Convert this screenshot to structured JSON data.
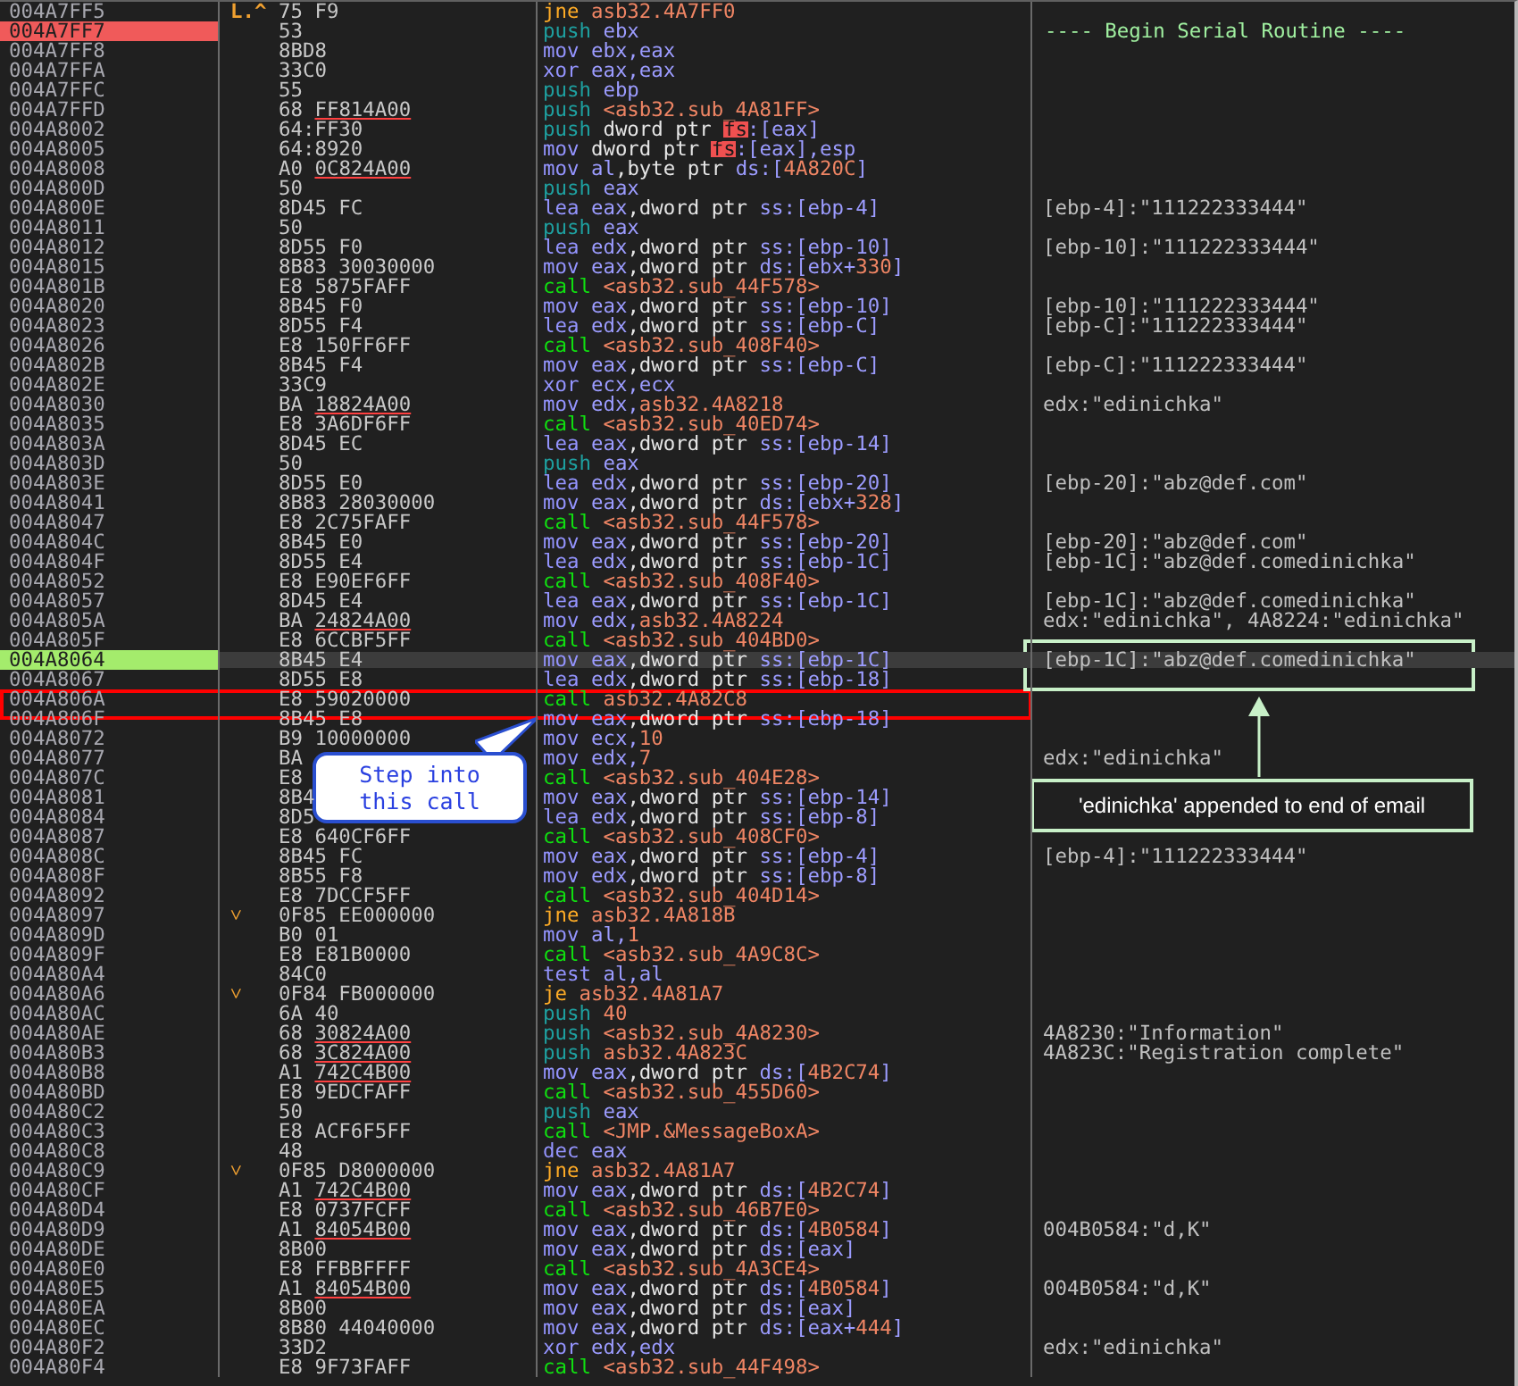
{
  "rows": [
    {
      "address": "004A7FF5",
      "branch_mark": "L.^",
      "bytes": "75 F9",
      "tokens": [
        {
          "text": "jne",
          "kind": "jump"
        },
        {
          "text": "asb32.4A7FF0",
          "kind": "address"
        }
      ],
      "breakpoint": false,
      "current": false
    },
    {
      "address": "004A7FF7",
      "bytes": "53",
      "tokens": [
        {
          "text": "push",
          "kind": "stack"
        },
        {
          "text": "ebx",
          "kind": "register"
        }
      ],
      "comment": {
        "text": "---- Begin Serial Routine ----",
        "kind": "label"
      },
      "breakpoint": true,
      "current": false
    },
    {
      "address": "004A7FF8",
      "bytes": "8BD8",
      "tokens": [
        {
          "text": "mov",
          "kind": "data"
        },
        {
          "text": "ebx,eax",
          "kind": "register"
        }
      ],
      "breakpoint": false,
      "current": false
    },
    {
      "address": "004A7FFA",
      "bytes": "33C0",
      "tokens": [
        {
          "text": "xor",
          "kind": "data"
        },
        {
          "text": "eax,eax",
          "kind": "register"
        }
      ],
      "breakpoint": false,
      "current": false
    },
    {
      "address": "004A7FFC",
      "bytes": "55",
      "tokens": [
        {
          "text": "push",
          "kind": "stack"
        },
        {
          "text": "ebp",
          "kind": "register"
        }
      ],
      "breakpoint": false,
      "current": false
    },
    {
      "address": "004A7FFD",
      "bytes": "68 ",
      "reloc": "FF814A00",
      "tokens": [
        {
          "text": "push",
          "kind": "stack"
        },
        {
          "text": "<asb32.sub_4A81FF>",
          "kind": "address"
        }
      ],
      "breakpoint": false,
      "current": false
    },
    {
      "address": "004A8002",
      "bytes": "64:FF30",
      "tokens": [
        {
          "text": "push",
          "kind": "stack"
        },
        {
          "text": "dword ptr ",
          "kind": "plain"
        },
        {
          "text": "fs",
          "kind": "segment"
        },
        {
          "text": ":[eax]",
          "kind": "register"
        }
      ],
      "breakpoint": false,
      "current": false
    },
    {
      "address": "004A8005",
      "bytes": "64:8920",
      "tokens": [
        {
          "text": "mov",
          "kind": "data"
        },
        {
          "text": "dword ptr ",
          "kind": "plain"
        },
        {
          "text": "fs",
          "kind": "segment"
        },
        {
          "text": ":[eax],esp",
          "kind": "register"
        }
      ],
      "breakpoint": false,
      "current": false
    },
    {
      "address": "004A8008",
      "bytes": "A0 ",
      "reloc": "0C824A00",
      "tokens": [
        {
          "text": "mov",
          "kind": "data"
        },
        {
          "text": "al",
          "kind": "register"
        },
        {
          "text": ",byte ptr ",
          "kind": "plain"
        },
        {
          "text": "ds:[",
          "kind": "register"
        },
        {
          "text": "4A820C",
          "kind": "address"
        },
        {
          "text": "]",
          "kind": "register"
        }
      ],
      "breakpoint": false,
      "current": false
    },
    {
      "address": "004A800D",
      "bytes": "50",
      "tokens": [
        {
          "text": "push",
          "kind": "stack"
        },
        {
          "text": "eax",
          "kind": "register"
        }
      ],
      "breakpoint": false,
      "current": false
    },
    {
      "address": "004A800E",
      "bytes": "8D45 FC",
      "tokens": [
        {
          "text": "lea",
          "kind": "data"
        },
        {
          "text": "eax",
          "kind": "register"
        },
        {
          "text": ",dword ptr ",
          "kind": "plain"
        },
        {
          "text": "ss:[ebp-4]",
          "kind": "register"
        }
      ],
      "comment": {
        "text": "[ebp-4]:\"111222333444\"",
        "kind": "auto"
      },
      "breakpoint": false,
      "current": false
    },
    {
      "address": "004A8011",
      "bytes": "50",
      "tokens": [
        {
          "text": "push",
          "kind": "stack"
        },
        {
          "text": "eax",
          "kind": "register"
        }
      ],
      "breakpoint": false,
      "current": false
    },
    {
      "address": "004A8012",
      "bytes": "8D55 F0",
      "tokens": [
        {
          "text": "lea",
          "kind": "data"
        },
        {
          "text": "edx",
          "kind": "register"
        },
        {
          "text": ",dword ptr ",
          "kind": "plain"
        },
        {
          "text": "ss:[ebp-10]",
          "kind": "register"
        }
      ],
      "comment": {
        "text": "[ebp-10]:\"111222333444\"",
        "kind": "auto"
      },
      "breakpoint": false,
      "current": false
    },
    {
      "address": "004A8015",
      "bytes": "8B83 30030000",
      "tokens": [
        {
          "text": "mov",
          "kind": "data"
        },
        {
          "text": "eax",
          "kind": "register"
        },
        {
          "text": ",dword ptr ",
          "kind": "plain"
        },
        {
          "text": "ds:[ebx+",
          "kind": "register"
        },
        {
          "text": "330",
          "kind": "address"
        },
        {
          "text": "]",
          "kind": "register"
        }
      ],
      "breakpoint": false,
      "current": false
    },
    {
      "address": "004A801B",
      "bytes": "E8 5875FAFF",
      "tokens": [
        {
          "text": "call",
          "kind": "call"
        },
        {
          "text": "<asb32.sub_44F578>",
          "kind": "address"
        }
      ],
      "breakpoint": false,
      "current": false
    },
    {
      "address": "004A8020",
      "bytes": "8B45 F0",
      "tokens": [
        {
          "text": "mov",
          "kind": "data"
        },
        {
          "text": "eax",
          "kind": "register"
        },
        {
          "text": ",dword ptr ",
          "kind": "plain"
        },
        {
          "text": "ss:[ebp-10]",
          "kind": "register"
        }
      ],
      "comment": {
        "text": "[ebp-10]:\"111222333444\"",
        "kind": "auto"
      },
      "breakpoint": false,
      "current": false
    },
    {
      "address": "004A8023",
      "bytes": "8D55 F4",
      "tokens": [
        {
          "text": "lea",
          "kind": "data"
        },
        {
          "text": "edx",
          "kind": "register"
        },
        {
          "text": ",dword ptr ",
          "kind": "plain"
        },
        {
          "text": "ss:[ebp-C]",
          "kind": "register"
        }
      ],
      "comment": {
        "text": "[ebp-C]:\"111222333444\"",
        "kind": "auto"
      },
      "breakpoint": false,
      "current": false
    },
    {
      "address": "004A8026",
      "bytes": "E8 150FF6FF",
      "tokens": [
        {
          "text": "call",
          "kind": "call"
        },
        {
          "text": "<asb32.sub_408F40>",
          "kind": "address"
        }
      ],
      "breakpoint": false,
      "current": false
    },
    {
      "address": "004A802B",
      "bytes": "8B45 F4",
      "tokens": [
        {
          "text": "mov",
          "kind": "data"
        },
        {
          "text": "eax",
          "kind": "register"
        },
        {
          "text": ",dword ptr ",
          "kind": "plain"
        },
        {
          "text": "ss:[ebp-C]",
          "kind": "register"
        }
      ],
      "comment": {
        "text": "[ebp-C]:\"111222333444\"",
        "kind": "auto"
      },
      "breakpoint": false,
      "current": false
    },
    {
      "address": "004A802E",
      "bytes": "33C9",
      "tokens": [
        {
          "text": "xor",
          "kind": "data"
        },
        {
          "text": "ecx,ecx",
          "kind": "register"
        }
      ],
      "breakpoint": false,
      "current": false
    },
    {
      "address": "004A8030",
      "bytes": "BA ",
      "reloc": "18824A00",
      "tokens": [
        {
          "text": "mov",
          "kind": "data"
        },
        {
          "text": "edx,",
          "kind": "register"
        },
        {
          "text": "asb32.4A8218",
          "kind": "address"
        }
      ],
      "comment": {
        "text": "edx:\"edinichka\"",
        "kind": "auto"
      },
      "breakpoint": false,
      "current": false
    },
    {
      "address": "004A8035",
      "bytes": "E8 3A6DF6FF",
      "tokens": [
        {
          "text": "call",
          "kind": "call"
        },
        {
          "text": "<asb32.sub_40ED74>",
          "kind": "address"
        }
      ],
      "breakpoint": false,
      "current": false
    },
    {
      "address": "004A803A",
      "bytes": "8D45 EC",
      "tokens": [
        {
          "text": "lea",
          "kind": "data"
        },
        {
          "text": "eax",
          "kind": "register"
        },
        {
          "text": ",dword ptr ",
          "kind": "plain"
        },
        {
          "text": "ss:[ebp-14]",
          "kind": "register"
        }
      ],
      "breakpoint": false,
      "current": false
    },
    {
      "address": "004A803D",
      "bytes": "50",
      "tokens": [
        {
          "text": "push",
          "kind": "stack"
        },
        {
          "text": "eax",
          "kind": "register"
        }
      ],
      "breakpoint": false,
      "current": false
    },
    {
      "address": "004A803E",
      "bytes": "8D55 E0",
      "tokens": [
        {
          "text": "lea",
          "kind": "data"
        },
        {
          "text": "edx",
          "kind": "register"
        },
        {
          "text": ",dword ptr ",
          "kind": "plain"
        },
        {
          "text": "ss:[ebp-20]",
          "kind": "register"
        }
      ],
      "comment": {
        "text": "[ebp-20]:\"abz@def.com\"",
        "kind": "auto"
      },
      "breakpoint": false,
      "current": false
    },
    {
      "address": "004A8041",
      "bytes": "8B83 28030000",
      "tokens": [
        {
          "text": "mov",
          "kind": "data"
        },
        {
          "text": "eax",
          "kind": "register"
        },
        {
          "text": ",dword ptr ",
          "kind": "plain"
        },
        {
          "text": "ds:[ebx+",
          "kind": "register"
        },
        {
          "text": "328",
          "kind": "address"
        },
        {
          "text": "]",
          "kind": "register"
        }
      ],
      "breakpoint": false,
      "current": false
    },
    {
      "address": "004A8047",
      "bytes": "E8 2C75FAFF",
      "tokens": [
        {
          "text": "call",
          "kind": "call"
        },
        {
          "text": "<asb32.sub_44F578>",
          "kind": "address"
        }
      ],
      "breakpoint": false,
      "current": false
    },
    {
      "address": "004A804C",
      "bytes": "8B45 E0",
      "tokens": [
        {
          "text": "mov",
          "kind": "data"
        },
        {
          "text": "eax",
          "kind": "register"
        },
        {
          "text": ",dword ptr ",
          "kind": "plain"
        },
        {
          "text": "ss:[ebp-20]",
          "kind": "register"
        }
      ],
      "comment": {
        "text": "[ebp-20]:\"abz@def.com\"",
        "kind": "auto"
      },
      "breakpoint": false,
      "current": false
    },
    {
      "address": "004A804F",
      "bytes": "8D55 E4",
      "tokens": [
        {
          "text": "lea",
          "kind": "data"
        },
        {
          "text": "edx",
          "kind": "register"
        },
        {
          "text": ",dword ptr ",
          "kind": "plain"
        },
        {
          "text": "ss:[ebp-1C]",
          "kind": "register"
        }
      ],
      "comment": {
        "text": "[ebp-1C]:\"abz@def.comedinichka\"",
        "kind": "auto"
      },
      "breakpoint": false,
      "current": false
    },
    {
      "address": "004A8052",
      "bytes": "E8 E90EF6FF",
      "tokens": [
        {
          "text": "call",
          "kind": "call"
        },
        {
          "text": "<asb32.sub_408F40>",
          "kind": "address"
        }
      ],
      "breakpoint": false,
      "current": false
    },
    {
      "address": "004A8057",
      "bytes": "8D45 E4",
      "tokens": [
        {
          "text": "lea",
          "kind": "data"
        },
        {
          "text": "eax",
          "kind": "register"
        },
        {
          "text": ",dword ptr ",
          "kind": "plain"
        },
        {
          "text": "ss:[ebp-1C]",
          "kind": "register"
        }
      ],
      "comment": {
        "text": "[ebp-1C]:\"abz@def.comedinichka\"",
        "kind": "auto"
      },
      "breakpoint": false,
      "current": false
    },
    {
      "address": "004A805A",
      "bytes": "BA ",
      "reloc": "24824A00",
      "tokens": [
        {
          "text": "mov",
          "kind": "data"
        },
        {
          "text": "edx,",
          "kind": "register"
        },
        {
          "text": "asb32.4A8224",
          "kind": "address"
        }
      ],
      "comment": {
        "text": "edx:\"edinichka\", 4A8224:\"edinichka\"",
        "kind": "auto"
      },
      "breakpoint": false,
      "current": false
    },
    {
      "address": "004A805F",
      "bytes": "E8 6CCBF5FF",
      "tokens": [
        {
          "text": "call",
          "kind": "call"
        },
        {
          "text": "<asb32.sub_404BD0>",
          "kind": "address"
        }
      ],
      "breakpoint": false,
      "current": false
    },
    {
      "address": "004A8064",
      "bytes": "8B45 E4",
      "tokens": [
        {
          "text": "mov",
          "kind": "data"
        },
        {
          "text": "eax",
          "kind": "register"
        },
        {
          "text": ",dword ptr ",
          "kind": "plain"
        },
        {
          "text": "ss:[ebp-1C]",
          "kind": "register"
        }
      ],
      "comment": {
        "text": "[ebp-1C]:\"abz@def.comedinichka\"",
        "kind": "auto"
      },
      "breakpoint": false,
      "current": true
    },
    {
      "address": "004A8067",
      "bytes": "8D55 E8",
      "tokens": [
        {
          "text": "lea",
          "kind": "data"
        },
        {
          "text": "edx",
          "kind": "register"
        },
        {
          "text": ",dword ptr ",
          "kind": "plain"
        },
        {
          "text": "ss:[ebp-18]",
          "kind": "register"
        }
      ],
      "breakpoint": false,
      "current": false
    },
    {
      "address": "004A806A",
      "bytes": "E8 59020000",
      "tokens": [
        {
          "text": "call",
          "kind": "call"
        },
        {
          "text": "asb32.4A82C8",
          "kind": "address"
        }
      ],
      "breakpoint": false,
      "current": false
    },
    {
      "address": "004A806F",
      "bytes": "8B45 E8",
      "tokens": [
        {
          "text": "mov",
          "kind": "data"
        },
        {
          "text": "eax",
          "kind": "register"
        },
        {
          "text": ",dword ptr ",
          "kind": "plain"
        },
        {
          "text": "ss:[ebp-18]",
          "kind": "register"
        }
      ],
      "breakpoint": false,
      "current": false
    },
    {
      "address": "004A8072",
      "bytes": "B9 10000000",
      "tokens": [
        {
          "text": "mov",
          "kind": "data"
        },
        {
          "text": "ecx,",
          "kind": "register"
        },
        {
          "text": "10",
          "kind": "address"
        }
      ],
      "breakpoint": false,
      "current": false
    },
    {
      "address": "004A8077",
      "bytes": "BA",
      "tokens": [
        {
          "text": "mov",
          "kind": "data"
        },
        {
          "text": "edx,",
          "kind": "register"
        },
        {
          "text": "7",
          "kind": "address"
        }
      ],
      "comment": {
        "text": "edx:\"edinichka\"",
        "kind": "auto"
      },
      "breakpoint": false,
      "current": false
    },
    {
      "address": "004A807C",
      "bytes": "E8",
      "tokens": [
        {
          "text": "call",
          "kind": "call"
        },
        {
          "text": "<asb32.sub_404E28>",
          "kind": "address"
        }
      ],
      "breakpoint": false,
      "current": false
    },
    {
      "address": "004A8081",
      "bytes": "8B4",
      "tokens": [
        {
          "text": "mov",
          "kind": "data"
        },
        {
          "text": "eax",
          "kind": "register"
        },
        {
          "text": ",dword ptr ",
          "kind": "plain"
        },
        {
          "text": "ss:[ebp-14]",
          "kind": "register"
        }
      ],
      "breakpoint": false,
      "current": false
    },
    {
      "address": "004A8084",
      "bytes": "8D5",
      "tokens": [
        {
          "text": "lea",
          "kind": "data"
        },
        {
          "text": "edx",
          "kind": "register"
        },
        {
          "text": ",dword ptr ",
          "kind": "plain"
        },
        {
          "text": "ss:[ebp-8]",
          "kind": "register"
        }
      ],
      "breakpoint": false,
      "current": false
    },
    {
      "address": "004A8087",
      "bytes": "E8 640CF6FF",
      "tokens": [
        {
          "text": "call",
          "kind": "call"
        },
        {
          "text": "<asb32.sub_408CF0>",
          "kind": "address"
        }
      ],
      "breakpoint": false,
      "current": false
    },
    {
      "address": "004A808C",
      "bytes": "8B45 FC",
      "tokens": [
        {
          "text": "mov",
          "kind": "data"
        },
        {
          "text": "eax",
          "kind": "register"
        },
        {
          "text": ",dword ptr ",
          "kind": "plain"
        },
        {
          "text": "ss:[ebp-4]",
          "kind": "register"
        }
      ],
      "comment": {
        "text": "[ebp-4]:\"111222333444\"",
        "kind": "auto"
      },
      "breakpoint": false,
      "current": false
    },
    {
      "address": "004A808F",
      "bytes": "8B55 F8",
      "tokens": [
        {
          "text": "mov",
          "kind": "data"
        },
        {
          "text": "edx",
          "kind": "register"
        },
        {
          "text": ",dword ptr ",
          "kind": "plain"
        },
        {
          "text": "ss:[ebp-8]",
          "kind": "register"
        }
      ],
      "breakpoint": false,
      "current": false
    },
    {
      "address": "004A8092",
      "bytes": "E8 7DCCF5FF",
      "tokens": [
        {
          "text": "call",
          "kind": "call"
        },
        {
          "text": "<asb32.sub_404D14>",
          "kind": "address"
        }
      ],
      "breakpoint": false,
      "current": false
    },
    {
      "address": "004A8097",
      "branch_mark": "˅",
      "bytes": "0F85 EE000000",
      "tokens": [
        {
          "text": "jne",
          "kind": "jump"
        },
        {
          "text": "asb32.4A818B",
          "kind": "address"
        }
      ],
      "breakpoint": false,
      "current": false
    },
    {
      "address": "004A809D",
      "bytes": "B0 01",
      "tokens": [
        {
          "text": "mov",
          "kind": "data"
        },
        {
          "text": "al,",
          "kind": "register"
        },
        {
          "text": "1",
          "kind": "address"
        }
      ],
      "breakpoint": false,
      "current": false
    },
    {
      "address": "004A809F",
      "bytes": "E8 E81B0000",
      "tokens": [
        {
          "text": "call",
          "kind": "call"
        },
        {
          "text": "<asb32.sub_4A9C8C>",
          "kind": "address"
        }
      ],
      "breakpoint": false,
      "current": false
    },
    {
      "address": "004A80A4",
      "bytes": "84C0",
      "tokens": [
        {
          "text": "test",
          "kind": "data"
        },
        {
          "text": "al,al",
          "kind": "register"
        }
      ],
      "breakpoint": false,
      "current": false
    },
    {
      "address": "004A80A6",
      "branch_mark": "˅",
      "bytes": "0F84 FB000000",
      "tokens": [
        {
          "text": "je",
          "kind": "jump"
        },
        {
          "text": "asb32.4A81A7",
          "kind": "address"
        }
      ],
      "breakpoint": false,
      "current": false
    },
    {
      "address": "004A80AC",
      "bytes": "6A 40",
      "tokens": [
        {
          "text": "push",
          "kind": "stack"
        },
        {
          "text": "40",
          "kind": "address"
        }
      ],
      "breakpoint": false,
      "current": false
    },
    {
      "address": "004A80AE",
      "bytes": "68 ",
      "reloc": "30824A00",
      "tokens": [
        {
          "text": "push",
          "kind": "stack"
        },
        {
          "text": "<asb32.sub_4A8230>",
          "kind": "address"
        }
      ],
      "comment": {
        "text": "4A8230:\"Information\"",
        "kind": "auto"
      },
      "breakpoint": false,
      "current": false
    },
    {
      "address": "004A80B3",
      "bytes": "68 ",
      "reloc": "3C824A00",
      "tokens": [
        {
          "text": "push",
          "kind": "stack"
        },
        {
          "text": "asb32.4A823C",
          "kind": "address"
        }
      ],
      "comment": {
        "text": "4A823C:\"Registration complete\"",
        "kind": "auto"
      },
      "breakpoint": false,
      "current": false
    },
    {
      "address": "004A80B8",
      "bytes": "A1 ",
      "reloc": "742C4B00",
      "tokens": [
        {
          "text": "mov",
          "kind": "data"
        },
        {
          "text": "eax",
          "kind": "register"
        },
        {
          "text": ",dword ptr ",
          "kind": "plain"
        },
        {
          "text": "ds:[",
          "kind": "register"
        },
        {
          "text": "4B2C74",
          "kind": "address"
        },
        {
          "text": "]",
          "kind": "register"
        }
      ],
      "breakpoint": false,
      "current": false
    },
    {
      "address": "004A80BD",
      "bytes": "E8 9EDCFAFF",
      "tokens": [
        {
          "text": "call",
          "kind": "call"
        },
        {
          "text": "<asb32.sub_455D60>",
          "kind": "address"
        }
      ],
      "breakpoint": false,
      "current": false
    },
    {
      "address": "004A80C2",
      "bytes": "50",
      "tokens": [
        {
          "text": "push",
          "kind": "stack"
        },
        {
          "text": "eax",
          "kind": "register"
        }
      ],
      "breakpoint": false,
      "current": false
    },
    {
      "address": "004A80C3",
      "bytes": "E8 ACF6F5FF",
      "tokens": [
        {
          "text": "call",
          "kind": "call"
        },
        {
          "text": "<JMP.&MessageBoxA>",
          "kind": "address"
        }
      ],
      "breakpoint": false,
      "current": false
    },
    {
      "address": "004A80C8",
      "bytes": "48",
      "tokens": [
        {
          "text": "dec",
          "kind": "data"
        },
        {
          "text": "eax",
          "kind": "register"
        }
      ],
      "breakpoint": false,
      "current": false
    },
    {
      "address": "004A80C9",
      "branch_mark": "˅",
      "bytes": "0F85 D8000000",
      "tokens": [
        {
          "text": "jne",
          "kind": "jump"
        },
        {
          "text": "asb32.4A81A7",
          "kind": "address"
        }
      ],
      "breakpoint": false,
      "current": false
    },
    {
      "address": "004A80CF",
      "bytes": "A1 ",
      "reloc": "742C4B00",
      "tokens": [
        {
          "text": "mov",
          "kind": "data"
        },
        {
          "text": "eax",
          "kind": "register"
        },
        {
          "text": ",dword ptr ",
          "kind": "plain"
        },
        {
          "text": "ds:[",
          "kind": "register"
        },
        {
          "text": "4B2C74",
          "kind": "address"
        },
        {
          "text": "]",
          "kind": "register"
        }
      ],
      "breakpoint": false,
      "current": false
    },
    {
      "address": "004A80D4",
      "bytes": "E8 0737FCFF",
      "tokens": [
        {
          "text": "call",
          "kind": "call"
        },
        {
          "text": "<asb32.sub_46B7E0>",
          "kind": "address"
        }
      ],
      "breakpoint": false,
      "current": false
    },
    {
      "address": "004A80D9",
      "bytes": "A1 ",
      "reloc": "84054B00",
      "tokens": [
        {
          "text": "mov",
          "kind": "data"
        },
        {
          "text": "eax",
          "kind": "register"
        },
        {
          "text": ",dword ptr ",
          "kind": "plain"
        },
        {
          "text": "ds:[",
          "kind": "register"
        },
        {
          "text": "4B0584",
          "kind": "address"
        },
        {
          "text": "]",
          "kind": "register"
        }
      ],
      "comment": {
        "text": "004B0584:\"d,K\"",
        "kind": "auto"
      },
      "breakpoint": false,
      "current": false
    },
    {
      "address": "004A80DE",
      "bytes": "8B00",
      "tokens": [
        {
          "text": "mov",
          "kind": "data"
        },
        {
          "text": "eax",
          "kind": "register"
        },
        {
          "text": ",dword ptr ",
          "kind": "plain"
        },
        {
          "text": "ds:[eax]",
          "kind": "register"
        }
      ],
      "breakpoint": false,
      "current": false
    },
    {
      "address": "004A80E0",
      "bytes": "E8 FFBBFFFF",
      "tokens": [
        {
          "text": "call",
          "kind": "call"
        },
        {
          "text": "<asb32.sub_4A3CE4>",
          "kind": "address"
        }
      ],
      "breakpoint": false,
      "current": false
    },
    {
      "address": "004A80E5",
      "bytes": "A1 ",
      "reloc": "84054B00",
      "tokens": [
        {
          "text": "mov",
          "kind": "data"
        },
        {
          "text": "eax",
          "kind": "register"
        },
        {
          "text": ",dword ptr ",
          "kind": "plain"
        },
        {
          "text": "ds:[",
          "kind": "register"
        },
        {
          "text": "4B0584",
          "kind": "address"
        },
        {
          "text": "]",
          "kind": "register"
        }
      ],
      "comment": {
        "text": "004B0584:\"d,K\"",
        "kind": "auto"
      },
      "breakpoint": false,
      "current": false
    },
    {
      "address": "004A80EA",
      "bytes": "8B00",
      "tokens": [
        {
          "text": "mov",
          "kind": "data"
        },
        {
          "text": "eax",
          "kind": "register"
        },
        {
          "text": ",dword ptr ",
          "kind": "plain"
        },
        {
          "text": "ds:[eax]",
          "kind": "register"
        }
      ],
      "breakpoint": false,
      "current": false
    },
    {
      "address": "004A80EC",
      "bytes": "8B80 44040000",
      "tokens": [
        {
          "text": "mov",
          "kind": "data"
        },
        {
          "text": "eax",
          "kind": "register"
        },
        {
          "text": ",dword ptr ",
          "kind": "plain"
        },
        {
          "text": "ds:[eax+",
          "kind": "register"
        },
        {
          "text": "444",
          "kind": "address"
        },
        {
          "text": "]",
          "kind": "register"
        }
      ],
      "breakpoint": false,
      "current": false
    },
    {
      "address": "004A80F2",
      "bytes": "33D2",
      "tokens": [
        {
          "text": "xor",
          "kind": "data"
        },
        {
          "text": "edx,edx",
          "kind": "register"
        }
      ],
      "comment": {
        "text": "edx:\"edinichka\"",
        "kind": "auto"
      },
      "breakpoint": false,
      "current": false
    },
    {
      "address": "004A80F4",
      "bytes": "E8 9F73FAFF",
      "tokens": [
        {
          "text": "call",
          "kind": "call"
        },
        {
          "text": "<asb32.sub_44F498>",
          "kind": "address"
        }
      ],
      "breakpoint": false,
      "current": false
    }
  ],
  "callout": {
    "text": "Step into this call"
  },
  "note": {
    "text": "'edinichka' appended to end of email"
  }
}
